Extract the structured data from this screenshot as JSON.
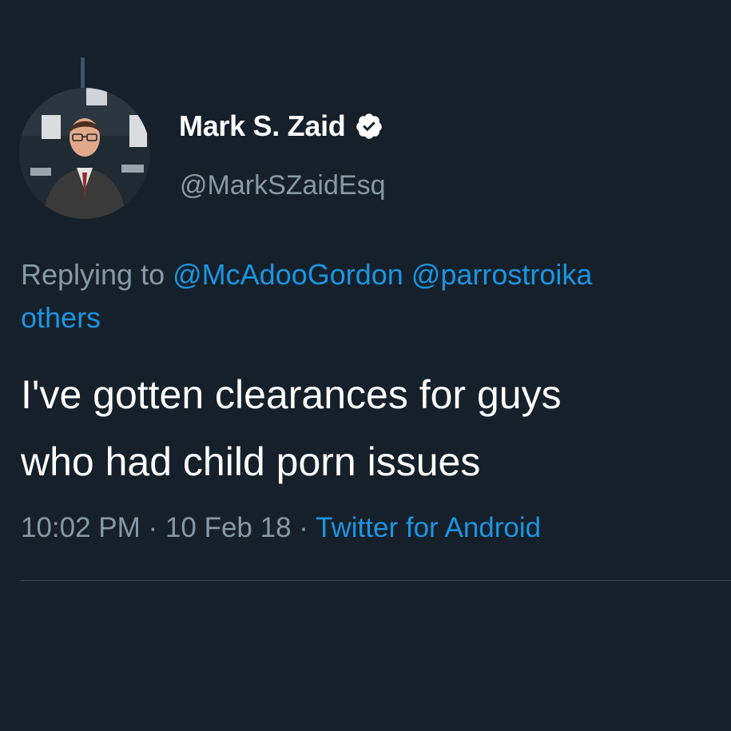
{
  "tweet": {
    "author": {
      "display_name": "Mark S. Zaid",
      "handle": "@MarkSZaidEsq",
      "verified": true,
      "avatar_icon": "profile-photo"
    },
    "reply_context": {
      "prefix": "Replying to",
      "mentions": [
        "@McAdooGordon",
        "@parrostroika"
      ],
      "others_label": "others"
    },
    "text_lines": [
      "I've gotten clearances for guys",
      "who had child porn issues"
    ],
    "meta": {
      "time": "10:02 PM",
      "separator": "·",
      "date": "10 Feb 18",
      "source": "Twitter for Android"
    }
  },
  "colors": {
    "background": "#15202b",
    "primary_text": "#ffffff",
    "secondary_text": "#8899a6",
    "link": "#1b95e0",
    "divider": "#38444d"
  }
}
